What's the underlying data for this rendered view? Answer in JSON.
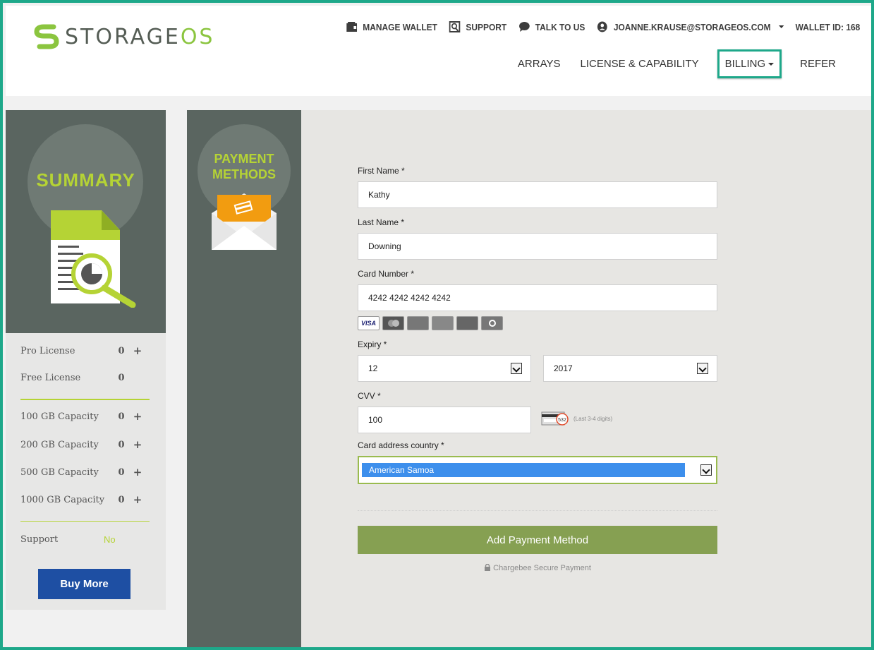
{
  "brand": {
    "logo_text_main": "STORAGE",
    "logo_text_accent": "OS",
    "accent_color": "#8bc53f",
    "frame_color": "#1ea88a"
  },
  "topbar": {
    "manage_wallet": "MANAGE WALLET",
    "support": "SUPPORT",
    "talk_to_us": "TALK TO US",
    "user_email": "JOANNE.KRAUSE@STORAGEOS.COM",
    "wallet_id": "WALLET ID: 168"
  },
  "nav": {
    "arrays": "ARRAYS",
    "license": "LICENSE & CAPABILITY",
    "billing": "BILLING",
    "refer": "REFER"
  },
  "summary": {
    "title": "SUMMARY",
    "items": [
      {
        "label": "Pro License",
        "value": "0",
        "plus": "+"
      },
      {
        "label": "Free License",
        "value": "0",
        "plus": ""
      },
      {
        "label": "100 GB Capacity",
        "value": "0",
        "plus": "+"
      },
      {
        "label": "200 GB Capacity",
        "value": "0",
        "plus": "+"
      },
      {
        "label": "500 GB Capacity",
        "value": "0",
        "plus": "+"
      },
      {
        "label": "1000 GB Capacity",
        "value": "0",
        "plus": "+"
      }
    ],
    "support_label": "Support",
    "support_value": "No",
    "buy_more": "Buy More"
  },
  "payment": {
    "title_line1": "PAYMENT",
    "title_line2": "METHODS",
    "first_name_label": "First Name *",
    "first_name": "Kathy",
    "last_name_label": "Last Name *",
    "last_name": "Downing",
    "card_number_label": "Card Number *",
    "card_number": "4242 4242 4242 4242",
    "card_brands": [
      "VISA",
      "MASTERCARD",
      "AMERICAN EXPRESS",
      "DISCOVER",
      "JCB",
      "Diners Club"
    ],
    "expiry_label": "Expiry *",
    "expiry_month": "12",
    "expiry_year": "2017",
    "cvv_label": "CVV *",
    "cvv": "100",
    "cvv_hint": "(Last 3-4 digits)",
    "cvv_sample": "532",
    "country_label": "Card address country *",
    "country": "American Samoa",
    "submit": "Add Payment Method",
    "secure_text": "Chargebee Secure Payment"
  }
}
